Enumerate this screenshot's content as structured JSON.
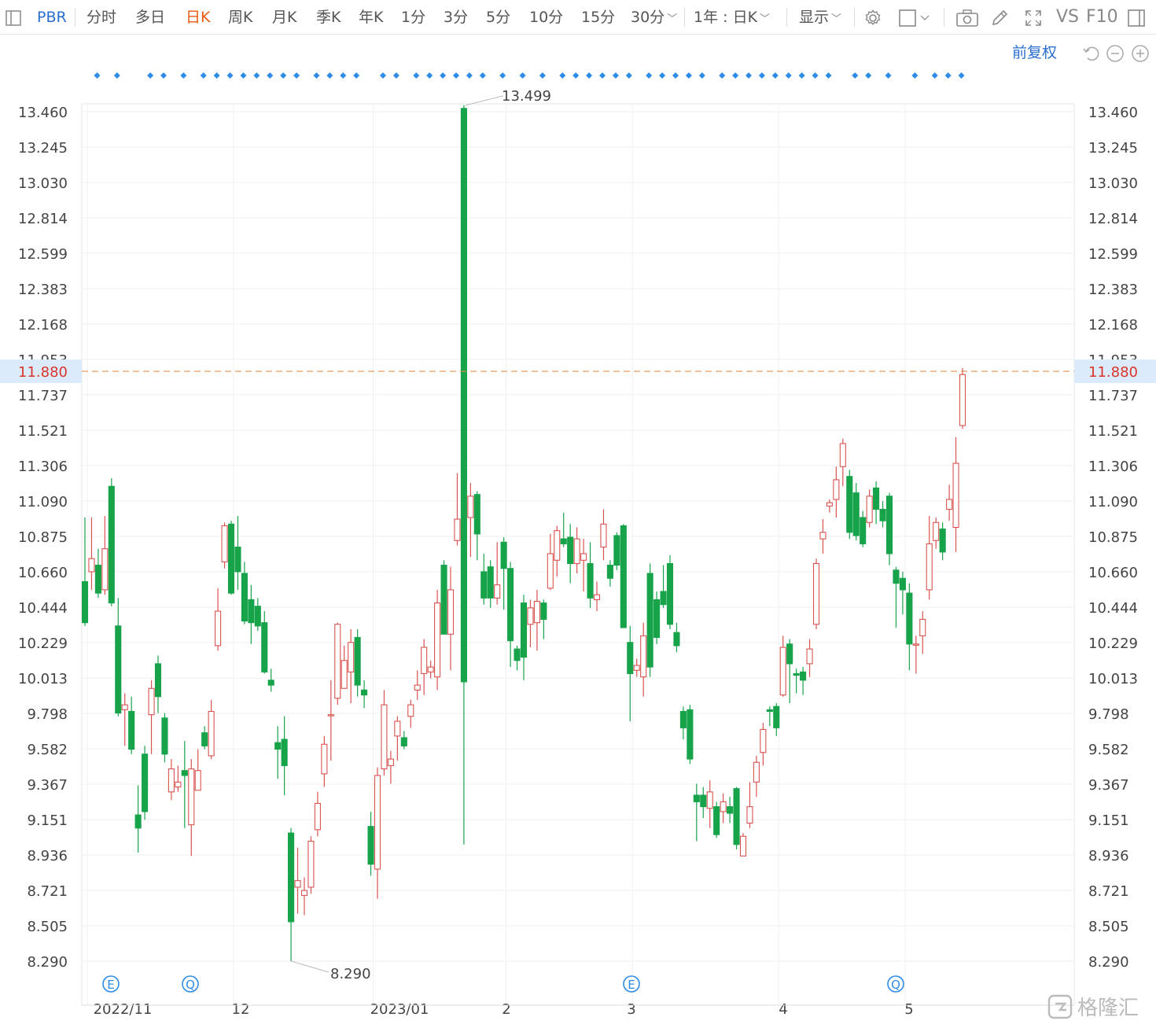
{
  "toolbar": {
    "symbol": "PBR",
    "tabs": [
      "分时",
      "多日",
      "日K",
      "周K",
      "月K",
      "季K",
      "年K",
      "1分",
      "3分",
      "5分",
      "10分",
      "15分",
      "30分"
    ],
    "active_tab": "日K",
    "range_label": "1年 : 日K",
    "display_label": "显示",
    "vs_label": "VS",
    "f10_label": "F10"
  },
  "subbar": {
    "adjust_label": "前复权"
  },
  "colors": {
    "up": "#d9534f",
    "down": "#16a34a",
    "accent": "#2a6fcf",
    "active": "#e8590c",
    "current_line": "#e8914a",
    "marker": "#2d8ce6"
  },
  "chart_data": {
    "type": "candlestick",
    "y_ticks": [
      "13.460",
      "13.245",
      "13.030",
      "12.814",
      "12.599",
      "12.383",
      "12.168",
      "11.953",
      "11.737",
      "11.521",
      "11.306",
      "11.090",
      "10.875",
      "10.660",
      "10.444",
      "10.229",
      "10.013",
      "9.798",
      "9.582",
      "9.367",
      "9.151",
      "8.936",
      "8.721",
      "8.505",
      "8.290"
    ],
    "ylim": [
      8.29,
      13.46
    ],
    "x_labels": [
      "2022/11",
      "12",
      "2023/01",
      "2",
      "3",
      "4",
      "5"
    ],
    "current_price": "11.880",
    "max_label": "13.499",
    "min_label": "8.290",
    "event_markers": [
      "E",
      "Q",
      "E",
      "Q"
    ],
    "candles": [
      [
        10.6,
        10.35,
        10.99,
        10.33
      ],
      [
        10.66,
        10.74,
        10.99,
        10.55
      ],
      [
        10.7,
        10.53,
        10.8,
        10.5
      ],
      [
        10.55,
        10.8,
        11.0,
        10.52
      ],
      [
        11.18,
        10.47,
        11.23,
        10.45
      ],
      [
        10.33,
        9.8,
        10.5,
        9.78
      ],
      [
        9.82,
        9.85,
        9.92,
        9.6
      ],
      [
        9.81,
        9.58,
        9.9,
        9.55
      ],
      [
        9.18,
        9.1,
        9.36,
        8.95
      ],
      [
        9.55,
        9.2,
        9.6,
        9.15
      ],
      [
        9.79,
        9.95,
        10.0,
        9.55
      ],
      [
        10.1,
        9.9,
        10.15,
        9.8
      ],
      [
        9.77,
        9.55,
        9.8,
        9.5
      ],
      [
        9.32,
        9.46,
        9.52,
        9.27
      ],
      [
        9.35,
        9.38,
        9.48,
        9.32
      ],
      [
        9.45,
        9.42,
        9.63,
        9.1
      ],
      [
        9.12,
        9.46,
        9.52,
        8.93
      ],
      [
        9.33,
        9.45,
        9.58,
        9.33
      ],
      [
        9.68,
        9.6,
        9.72,
        9.58
      ],
      [
        9.54,
        9.81,
        9.88,
        9.52
      ],
      [
        10.21,
        10.42,
        10.56,
        10.18
      ],
      [
        10.72,
        10.94,
        10.96,
        10.68
      ],
      [
        10.95,
        10.53,
        10.97,
        10.52
      ],
      [
        10.81,
        10.66,
        11.0,
        10.55
      ],
      [
        10.65,
        10.36,
        10.72,
        10.34
      ],
      [
        10.49,
        10.35,
        10.58,
        10.22
      ],
      [
        10.45,
        10.33,
        10.5,
        10.3
      ],
      [
        10.35,
        10.05,
        10.42,
        10.04
      ],
      [
        10.0,
        9.97,
        10.07,
        9.93
      ],
      [
        9.62,
        9.58,
        9.72,
        9.4
      ],
      [
        9.64,
        9.48,
        9.78,
        9.3
      ],
      [
        9.07,
        8.53,
        9.1,
        8.29
      ],
      [
        8.74,
        8.78,
        8.98,
        8.58
      ],
      [
        8.69,
        8.72,
        8.8,
        8.57
      ],
      [
        8.74,
        9.02,
        9.05,
        8.7
      ],
      [
        9.09,
        9.25,
        9.32,
        9.05
      ],
      [
        9.43,
        9.61,
        9.66,
        9.35
      ],
      [
        9.79,
        9.79,
        10.0,
        9.51
      ],
      [
        9.89,
        10.34,
        10.35,
        9.85
      ],
      [
        9.95,
        10.12,
        10.21,
        9.95
      ],
      [
        10.05,
        10.23,
        10.31,
        9.86
      ],
      [
        10.26,
        9.97,
        10.31,
        9.9
      ],
      [
        9.94,
        9.91,
        10.0,
        9.83
      ],
      [
        9.11,
        8.88,
        9.2,
        8.81
      ],
      [
        8.85,
        9.42,
        9.47,
        8.67
      ],
      [
        9.46,
        9.85,
        9.94,
        9.42
      ],
      [
        9.48,
        9.52,
        9.57,
        9.37
      ],
      [
        9.66,
        9.75,
        9.78,
        9.51
      ],
      [
        9.65,
        9.6,
        9.69,
        9.58
      ],
      [
        9.78,
        9.85,
        9.88,
        9.71
      ],
      [
        9.94,
        9.97,
        10.06,
        9.88
      ],
      [
        10.04,
        10.2,
        10.25,
        9.91
      ],
      [
        10.05,
        10.08,
        10.12,
        10.01
      ],
      [
        10.02,
        10.47,
        10.55,
        9.94
      ],
      [
        10.7,
        10.28,
        10.73,
        10.28
      ],
      [
        10.28,
        10.55,
        10.69,
        10.06
      ],
      [
        10.85,
        10.98,
        11.26,
        10.82
      ],
      [
        13.48,
        9.99,
        13.5,
        9.0
      ],
      [
        10.99,
        11.12,
        11.2,
        10.75
      ],
      [
        11.13,
        10.89,
        11.15,
        10.73
      ],
      [
        10.66,
        10.5,
        10.77,
        10.46
      ],
      [
        10.69,
        10.5,
        10.73,
        10.44
      ],
      [
        10.5,
        10.58,
        10.84,
        10.46
      ],
      [
        10.84,
        10.68,
        10.87,
        10.43
      ],
      [
        10.68,
        10.24,
        10.72,
        10.08
      ],
      [
        10.19,
        10.12,
        10.21,
        10.06
      ],
      [
        10.47,
        10.14,
        10.52,
        10.0
      ],
      [
        10.34,
        10.44,
        10.49,
        10.2
      ],
      [
        10.35,
        10.48,
        10.55,
        10.18
      ],
      [
        10.47,
        10.37,
        10.49,
        10.25
      ],
      [
        10.56,
        10.77,
        10.89,
        10.55
      ],
      [
        10.73,
        10.91,
        10.94,
        10.63
      ],
      [
        10.86,
        10.83,
        11.02,
        10.81
      ],
      [
        10.87,
        10.71,
        10.95,
        10.59
      ],
      [
        10.71,
        10.86,
        10.93,
        10.65
      ],
      [
        10.73,
        10.77,
        10.86,
        10.54
      ],
      [
        10.71,
        10.5,
        10.84,
        10.44
      ],
      [
        10.49,
        10.52,
        10.6,
        10.42
      ],
      [
        10.81,
        10.95,
        11.04,
        10.73
      ],
      [
        10.7,
        10.62,
        10.73,
        10.57
      ],
      [
        10.88,
        10.7,
        10.9,
        10.67
      ],
      [
        10.94,
        10.32,
        10.95,
        10.32
      ],
      [
        10.23,
        10.04,
        10.33,
        9.75
      ],
      [
        10.06,
        10.09,
        10.13,
        10.02
      ],
      [
        10.02,
        10.27,
        10.35,
        9.9
      ],
      [
        10.65,
        10.08,
        10.71,
        10.02
      ],
      [
        10.49,
        10.26,
        10.54,
        10.22
      ],
      [
        10.54,
        10.46,
        10.7,
        10.44
      ],
      [
        10.71,
        10.34,
        10.76,
        10.31
      ],
      [
        10.29,
        10.21,
        10.35,
        10.17
      ],
      [
        9.81,
        9.71,
        9.84,
        9.64
      ],
      [
        9.82,
        9.52,
        9.85,
        9.49
      ],
      [
        9.3,
        9.26,
        9.37,
        9.02
      ],
      [
        9.3,
        9.23,
        9.35,
        9.16
      ],
      [
        9.22,
        9.32,
        9.39,
        9.1
      ],
      [
        9.23,
        9.06,
        9.26,
        9.04
      ],
      [
        9.2,
        9.26,
        9.31,
        9.13
      ],
      [
        9.23,
        9.19,
        9.29,
        9.13
      ],
      [
        9.34,
        9.0,
        9.35,
        8.97
      ],
      [
        8.93,
        9.05,
        9.07,
        8.93
      ],
      [
        9.13,
        9.23,
        9.38,
        9.1
      ],
      [
        9.38,
        9.5,
        9.54,
        9.29
      ],
      [
        9.56,
        9.7,
        9.74,
        9.48
      ],
      [
        9.82,
        9.81,
        9.84,
        9.72
      ],
      [
        9.84,
        9.71,
        9.86,
        9.66
      ],
      [
        9.91,
        10.2,
        10.27,
        9.9
      ],
      [
        10.22,
        10.1,
        10.25,
        9.86
      ],
      [
        10.04,
        10.03,
        10.07,
        9.92
      ],
      [
        10.05,
        10.0,
        10.08,
        9.91
      ],
      [
        10.1,
        10.19,
        10.25,
        10.02
      ],
      [
        10.34,
        10.71,
        10.74,
        10.31
      ],
      [
        10.86,
        10.9,
        10.98,
        10.77
      ],
      [
        11.06,
        11.08,
        11.1,
        11.02
      ],
      [
        11.1,
        11.22,
        11.3,
        10.99
      ],
      [
        11.3,
        11.44,
        11.47,
        11.18
      ],
      [
        11.24,
        10.9,
        11.28,
        10.86
      ],
      [
        11.14,
        10.88,
        11.2,
        10.85
      ],
      [
        10.99,
        10.83,
        11.03,
        10.81
      ],
      [
        10.96,
        11.12,
        11.16,
        10.93
      ],
      [
        11.17,
        11.04,
        11.21,
        10.95
      ],
      [
        11.04,
        10.97,
        11.09,
        10.93
      ],
      [
        11.12,
        10.77,
        11.14,
        10.7
      ],
      [
        10.67,
        10.59,
        10.69,
        10.32
      ],
      [
        10.62,
        10.55,
        10.66,
        10.4
      ],
      [
        10.53,
        10.22,
        10.59,
        10.06
      ],
      [
        10.22,
        10.22,
        10.27,
        10.04
      ],
      [
        10.27,
        10.37,
        10.42,
        10.16
      ],
      [
        10.55,
        10.83,
        11.0,
        10.49
      ],
      [
        10.85,
        10.96,
        10.99,
        10.8
      ],
      [
        10.92,
        10.78,
        10.96,
        10.73
      ],
      [
        11.04,
        11.1,
        11.19,
        10.97
      ],
      [
        10.93,
        11.32,
        11.48,
        10.78
      ],
      [
        11.55,
        11.86,
        11.9,
        11.53
      ]
    ]
  }
}
